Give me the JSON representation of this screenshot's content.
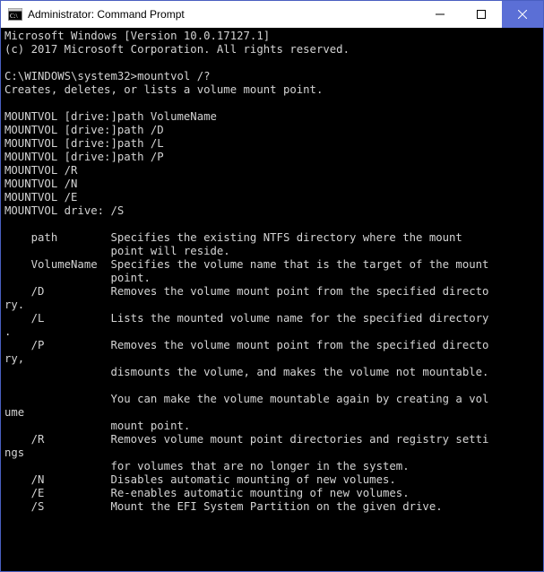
{
  "window": {
    "title": "Administrator: Command Prompt"
  },
  "terminal": {
    "lines": [
      "Microsoft Windows [Version 10.0.17127.1]",
      "(c) 2017 Microsoft Corporation. All rights reserved.",
      "",
      "C:\\WINDOWS\\system32>mountvol /?",
      "Creates, deletes, or lists a volume mount point.",
      "",
      "MOUNTVOL [drive:]path VolumeName",
      "MOUNTVOL [drive:]path /D",
      "MOUNTVOL [drive:]path /L",
      "MOUNTVOL [drive:]path /P",
      "MOUNTVOL /R",
      "MOUNTVOL /N",
      "MOUNTVOL /E",
      "MOUNTVOL drive: /S",
      "",
      "    path        Specifies the existing NTFS directory where the mount",
      "                point will reside.",
      "    VolumeName  Specifies the volume name that is the target of the mount",
      "                point.",
      "    /D          Removes the volume mount point from the specified directo",
      "ry.",
      "    /L          Lists the mounted volume name for the specified directory",
      ".",
      "    /P          Removes the volume mount point from the specified directo",
      "ry,",
      "                dismounts the volume, and makes the volume not mountable.",
      "",
      "                You can make the volume mountable again by creating a vol",
      "ume",
      "                mount point.",
      "    /R          Removes volume mount point directories and registry setti",
      "ngs",
      "                for volumes that are no longer in the system.",
      "    /N          Disables automatic mounting of new volumes.",
      "    /E          Re-enables automatic mounting of new volumes.",
      "    /S          Mount the EFI System Partition on the given drive.",
      ""
    ]
  }
}
